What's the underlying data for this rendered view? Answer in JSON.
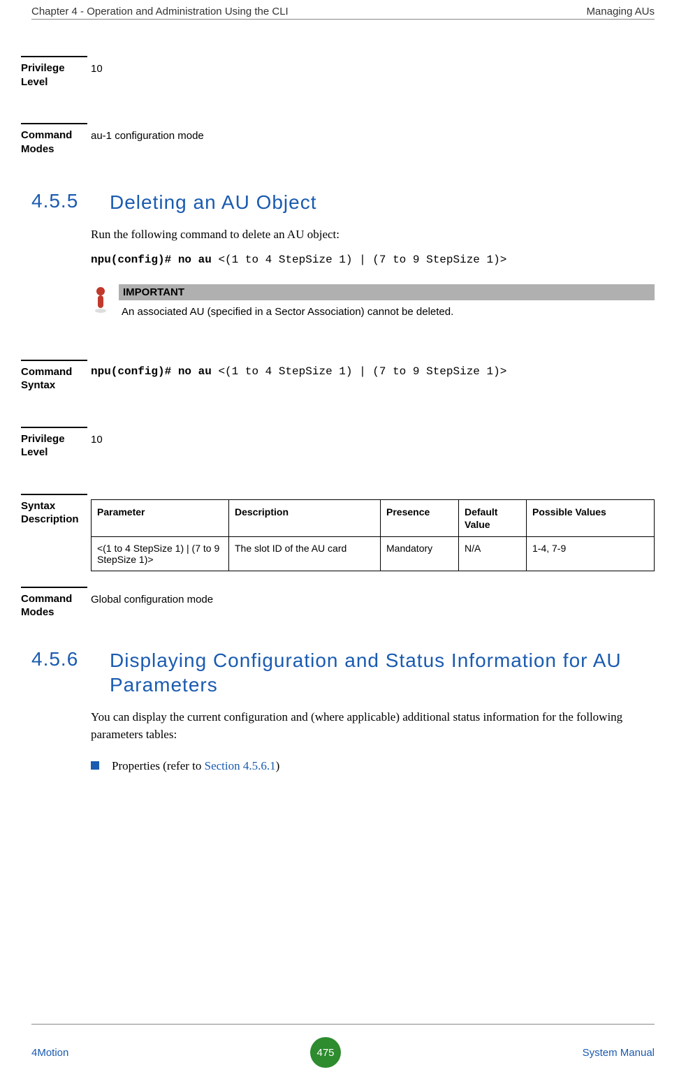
{
  "header": {
    "left": "Chapter 4 - Operation and Administration Using the CLI",
    "right": "Managing AUs"
  },
  "block1": {
    "label": "Privilege Level",
    "value": "10"
  },
  "block2": {
    "label": "Command Modes",
    "value": "au-1 configuration mode"
  },
  "section455": {
    "num": "4.5.5",
    "title": "Deleting an AU Object",
    "intro": "Run the following command to delete an AU object:",
    "cmd_prefix": "npu(config)# no au ",
    "cmd_rest": "<(1 to 4 StepSize 1) | (7 to 9 StepSize 1)>"
  },
  "important": {
    "header": "IMPORTANT",
    "body": "An associated AU (specified in a Sector Association) cannot be deleted."
  },
  "block3": {
    "label": "Command Syntax",
    "cmd_prefix": "npu(config)# no au ",
    "cmd_rest": "<(1 to 4 StepSize 1) | (7 to 9 StepSize 1)>"
  },
  "block4": {
    "label": "Privilege Level",
    "value": "10"
  },
  "block5": {
    "label": "Syntax Description",
    "headers": {
      "p": "Parameter",
      "d": "Description",
      "pr": "Presence",
      "dv": "Default Value",
      "pv": "Possible Values"
    },
    "row": {
      "p": " <(1 to 4 StepSize 1) | (7 to 9 StepSize 1)>",
      "d": "The slot ID of the AU card",
      "pr": "Mandatory",
      "dv": "N/A",
      "pv": "1-4, 7-9"
    }
  },
  "block6": {
    "label": "Command Modes",
    "value": "Global configuration mode"
  },
  "section456": {
    "num": "4.5.6",
    "title": "Displaying Configuration and Status Information for AU Parameters",
    "intro": "You can display the current configuration and (where applicable) additional status information for the following parameters tables:",
    "bullet_pre": "Properties (refer to ",
    "bullet_link": "Section 4.5.6.1",
    "bullet_post": ")"
  },
  "footer": {
    "left": "4Motion",
    "page": "475",
    "right": " System Manual"
  }
}
